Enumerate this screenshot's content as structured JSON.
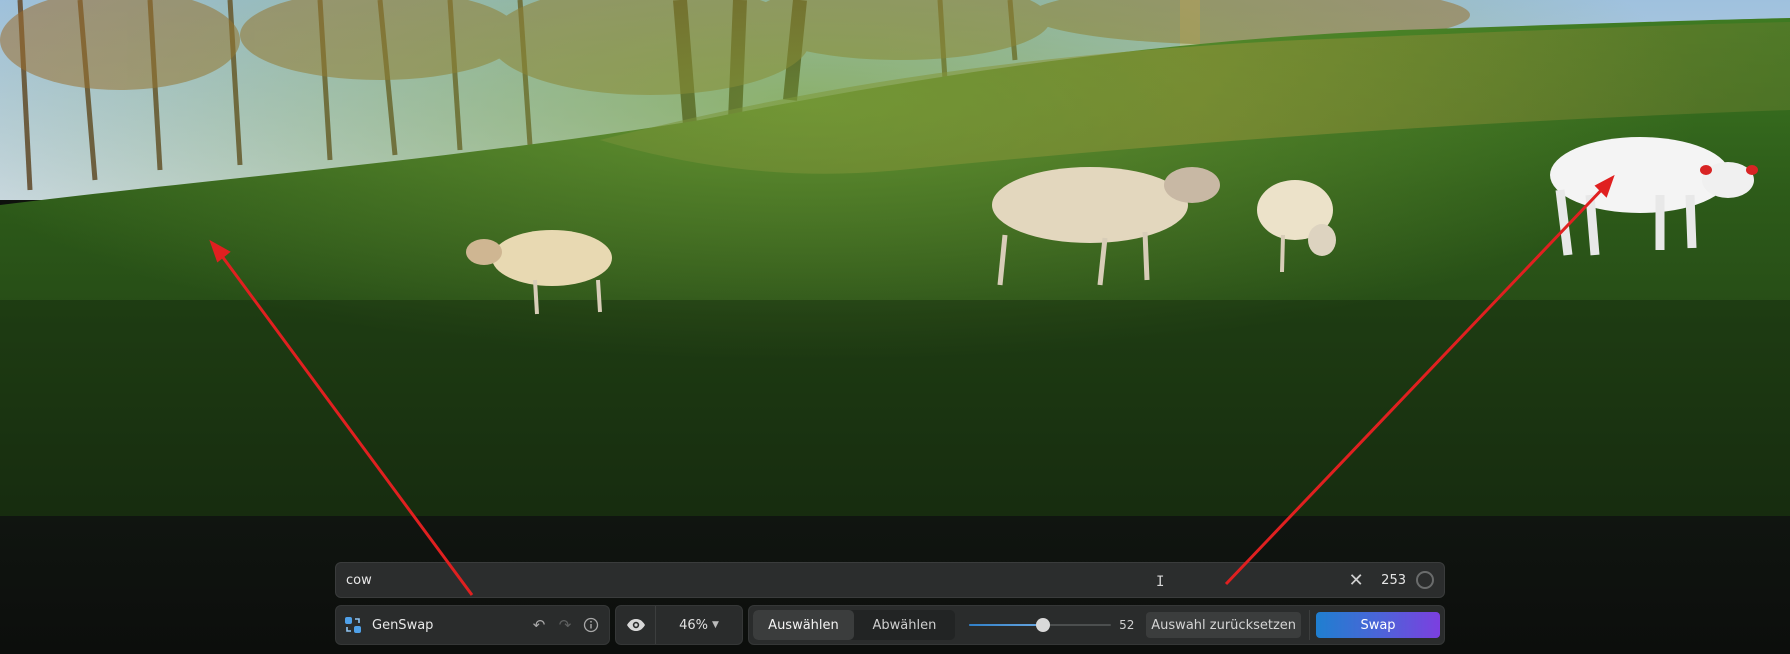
{
  "prompt": {
    "value": "cow",
    "clear_icon": "close-icon",
    "char_count": "253",
    "count_ring_icon": "progress-ring-icon"
  },
  "toolbar": {
    "app_name": "GenSwap",
    "undo_icon": "undo-icon",
    "redo_icon": "redo-icon",
    "info_icon": "info-icon",
    "visibility_icon": "eye-icon",
    "zoom": "46%",
    "mode_select": "Auswählen",
    "mode_deselect": "Abwählen",
    "brush_size": 52,
    "brush_size_label": "52",
    "brush_size_max": 100,
    "reset_label": "Auswahl zurücksetzen",
    "swap_label": "Swap"
  },
  "colors": {
    "accent_blue": "#1f7fd0",
    "accent_purple": "#7c3fe0",
    "annotation_arrow": "#e02020"
  }
}
